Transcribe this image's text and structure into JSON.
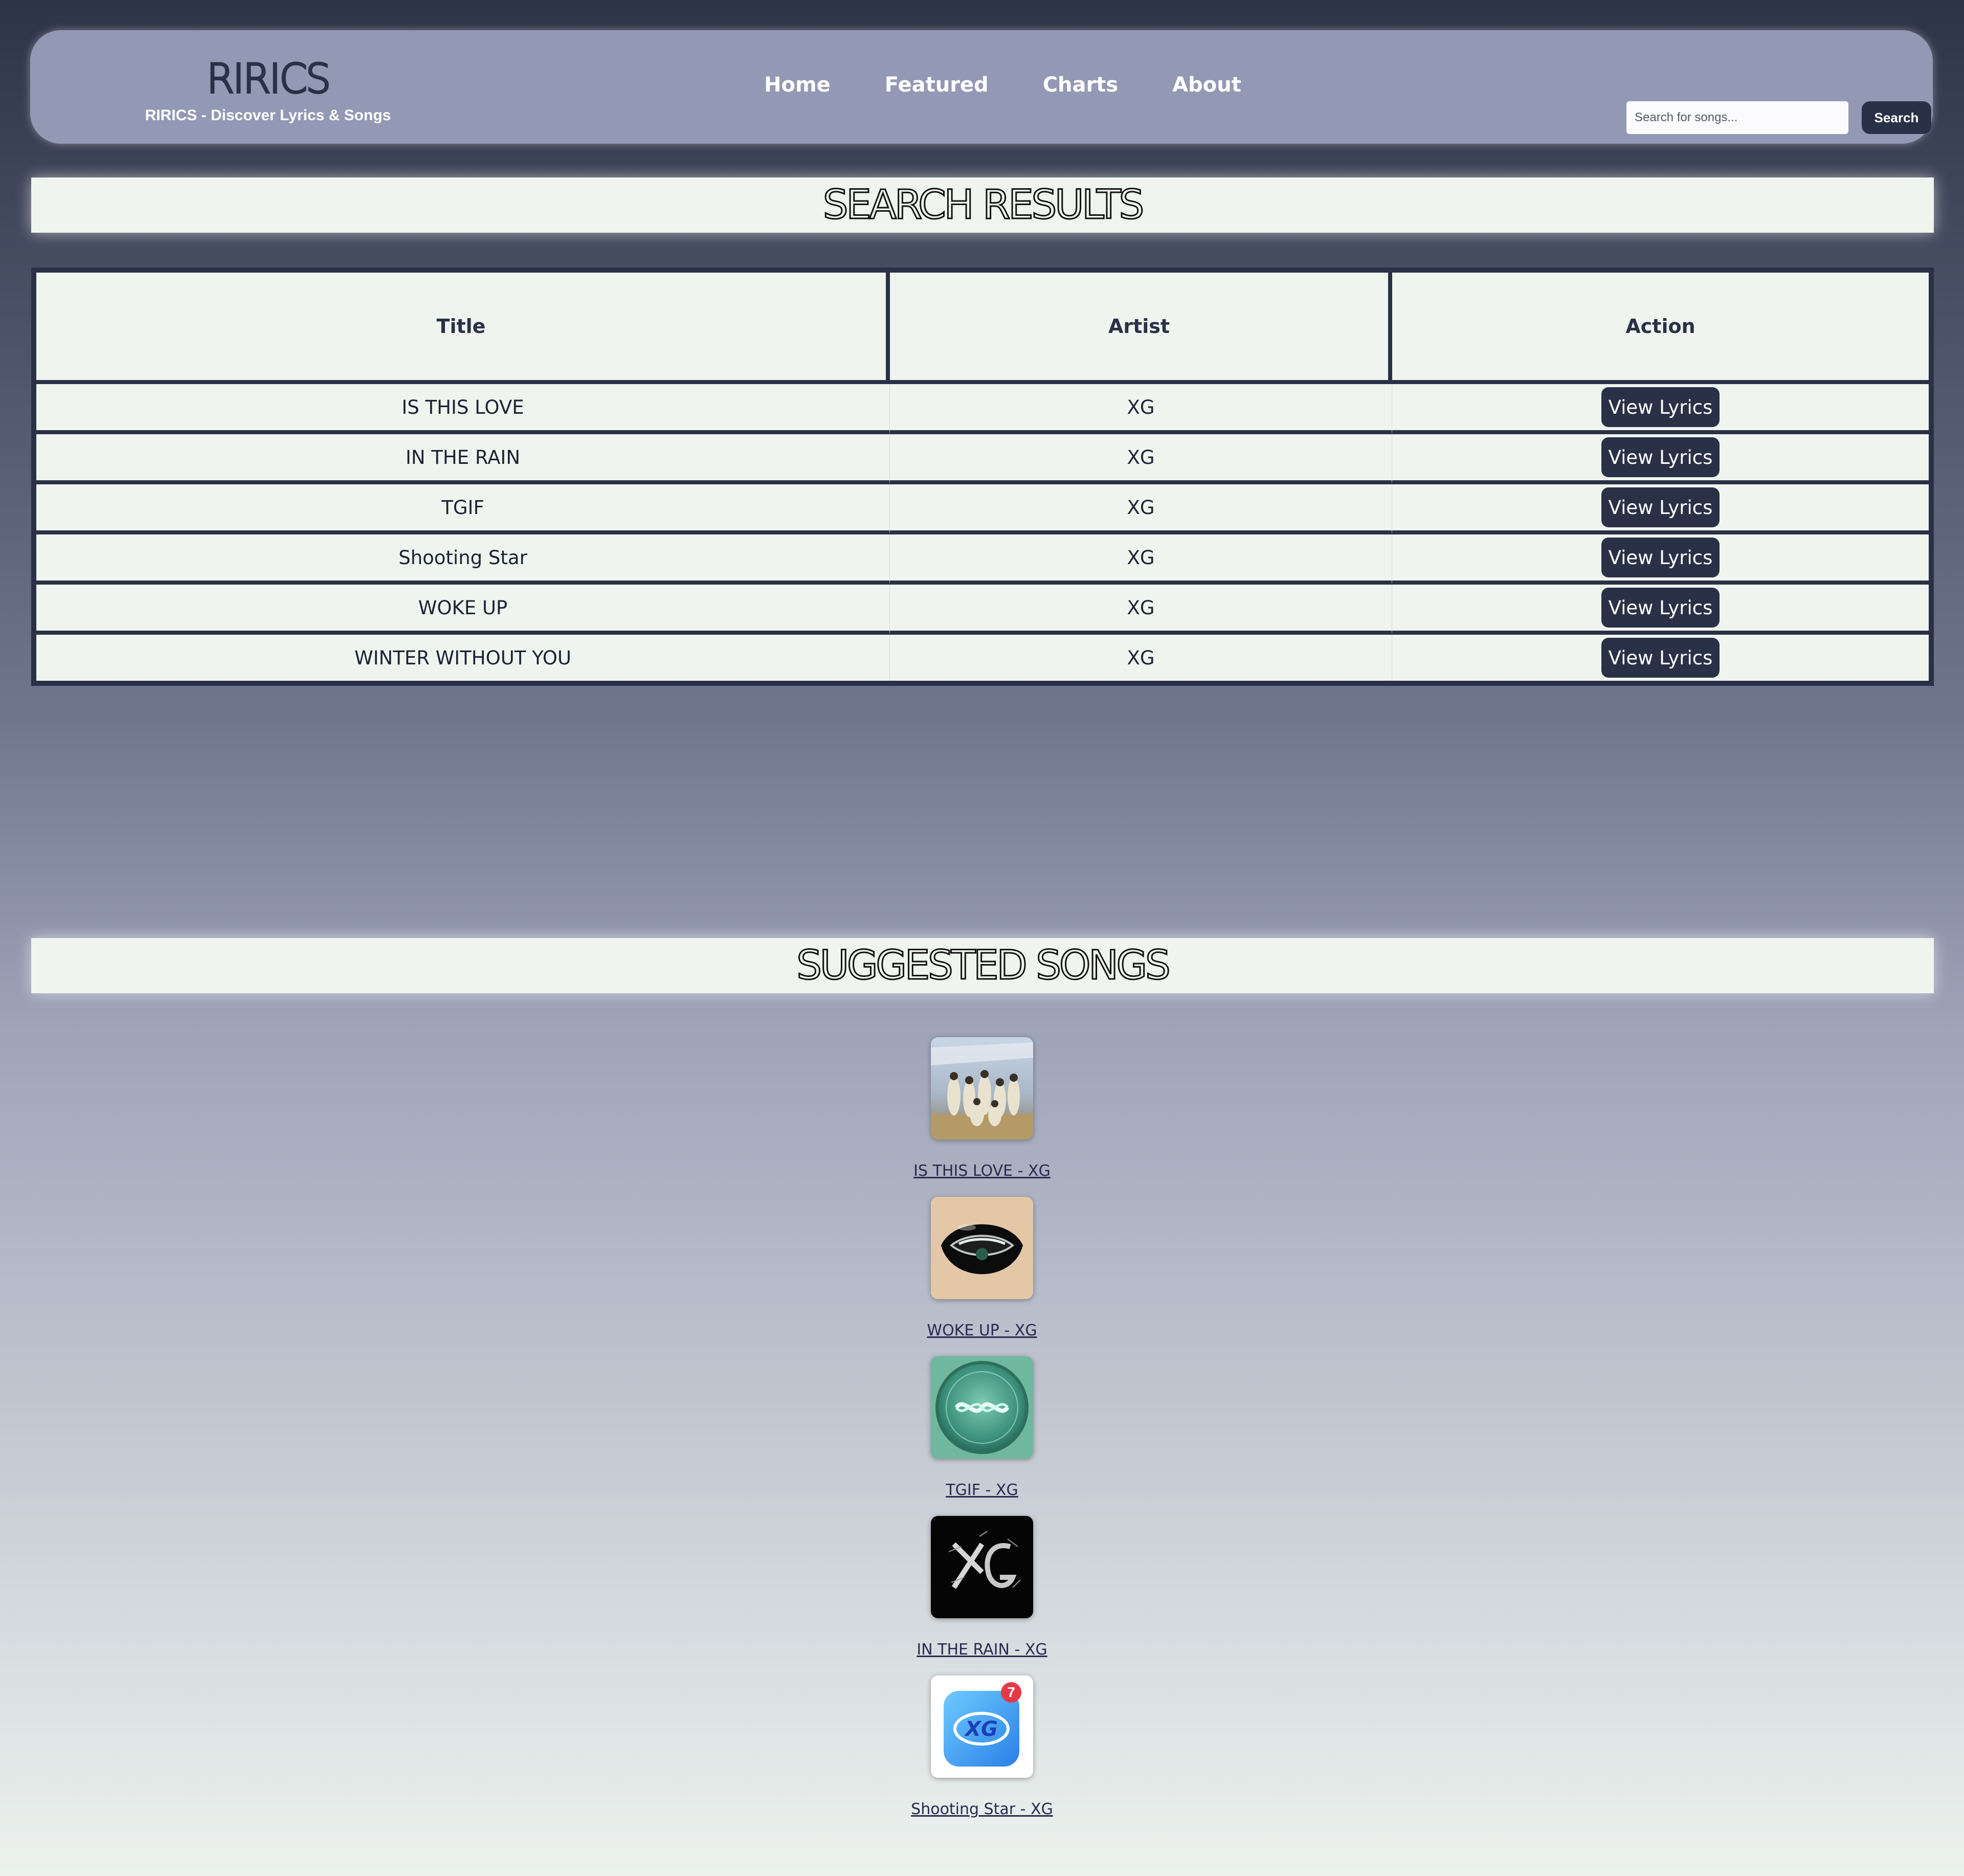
{
  "brand": {
    "logo": "RIRICS",
    "tagline": "RIRICS - Discover Lyrics & Songs"
  },
  "nav": {
    "items": [
      {
        "label": "Home"
      },
      {
        "label": "Featured"
      },
      {
        "label": "Charts"
      },
      {
        "label": "About"
      }
    ]
  },
  "search": {
    "placeholder": "Search for songs...",
    "value": "",
    "button_label": "Search"
  },
  "results": {
    "heading": "SEARCH RESULTS",
    "columns": [
      "Title",
      "Artist",
      "Action"
    ],
    "rows": [
      {
        "title": "IS THIS LOVE",
        "artist": "XG",
        "action": "View Lyrics"
      },
      {
        "title": "IN THE RAIN",
        "artist": "XG",
        "action": "View Lyrics"
      },
      {
        "title": "TGIF",
        "artist": "XG",
        "action": "View Lyrics"
      },
      {
        "title": "Shooting Star",
        "artist": "XG",
        "action": "View Lyrics"
      },
      {
        "title": "WOKE UP",
        "artist": "XG",
        "action": "View Lyrics"
      },
      {
        "title": "WINTER WITHOUT YOU",
        "artist": "XG",
        "action": "View Lyrics"
      }
    ]
  },
  "suggested": {
    "heading": "SUGGESTED SONGS",
    "items": [
      {
        "label": "IS THIS LOVE - XG",
        "cover": "group-photo-cover"
      },
      {
        "label": "WOKE UP - XG",
        "cover": "black-lips-cover"
      },
      {
        "label": "TGIF - XG",
        "cover": "green-glass-disc-cover"
      },
      {
        "label": "IN THE RAIN - XG",
        "cover": "chrome-xg-logo-cover"
      },
      {
        "label": "Shooting Star - XG",
        "cover": "blue-app-icon-cover",
        "badge": "7"
      }
    ]
  },
  "colors": {
    "navy": "#2a3146",
    "header_bg": "#9399b4",
    "panel_bg": "#eff4ee"
  }
}
